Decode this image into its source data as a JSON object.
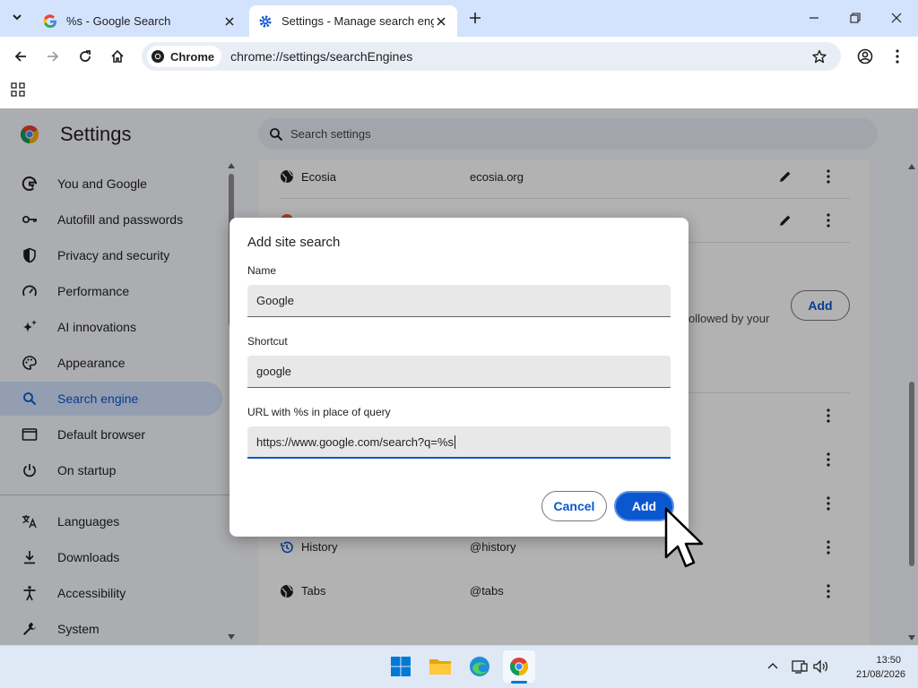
{
  "browser": {
    "tabs": [
      {
        "title": "%s - Google Search",
        "favicon": "google-g-icon",
        "active": false
      },
      {
        "title": "Settings - Manage search engines",
        "favicon": "gear-icon",
        "active": true
      }
    ],
    "omnibox_chip": "Chrome",
    "url": "chrome://settings/searchEngines"
  },
  "settings": {
    "title": "Settings",
    "search_placeholder": "Search settings",
    "sidebar": [
      {
        "label": "You and Google",
        "icon": "google-g-icon"
      },
      {
        "label": "Autofill and passwords",
        "icon": "key-icon"
      },
      {
        "label": "Privacy and security",
        "icon": "shield-icon"
      },
      {
        "label": "Performance",
        "icon": "speedometer-icon"
      },
      {
        "label": "AI innovations",
        "icon": "sparkle-icon"
      },
      {
        "label": "Appearance",
        "icon": "palette-icon"
      },
      {
        "label": "Search engine",
        "icon": "search-icon",
        "selected": true
      },
      {
        "label": "Default browser",
        "icon": "browser-window-icon"
      },
      {
        "label": "On startup",
        "icon": "power-icon"
      },
      {
        "label": "Languages",
        "icon": "translate-icon"
      },
      {
        "label": "Downloads",
        "icon": "download-icon"
      },
      {
        "label": "Accessibility",
        "icon": "accessibility-icon"
      },
      {
        "label": "System",
        "icon": "wrench-icon"
      }
    ],
    "rows": [
      {
        "name": "Ecosia",
        "keyword": "ecosia.org",
        "editable": true
      },
      {
        "name": "History",
        "keyword": "@history",
        "editable": false
      },
      {
        "name": "Tabs",
        "keyword": "@tabs",
        "editable": false
      }
    ],
    "add_button": "Add",
    "partial_description": "ollowed by your"
  },
  "dialog": {
    "title": "Add site search",
    "name_label": "Name",
    "name_value": "Google",
    "shortcut_label": "Shortcut",
    "shortcut_value": "google",
    "url_label": "URL with %s in place of query",
    "url_value": "https://www.google.com/search?q=%s",
    "cancel": "Cancel",
    "add": "Add"
  },
  "taskbar": {
    "apps": [
      "windows-start-icon",
      "file-explorer-icon",
      "edge-icon",
      "chrome-icon"
    ],
    "time": "13:50",
    "date": "21/08/2026"
  }
}
